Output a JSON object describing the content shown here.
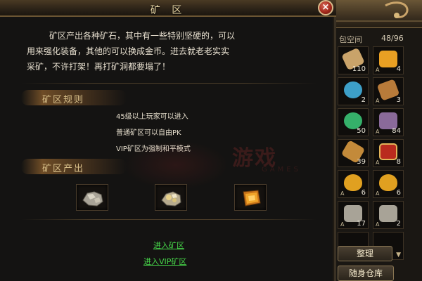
{
  "dialog": {
    "title": "矿 区",
    "close_icon": "×",
    "intro_lines": [
      "矿区产出各种矿石，其中有一些特别坚硬的，可以",
      "用来强化装备，其他的可以换成金币。进去就老老实实",
      "采矿，不许打架！再打矿洞都要塌了！"
    ],
    "rules_title": "矿区规则",
    "rules": [
      "45级以上玩家可以进入",
      "普通矿区可以自由PK",
      "VIP矿区为强制和平模式"
    ],
    "output_title": "矿区产出",
    "output_items": [
      {
        "icon": "silver-ore-icon",
        "color": "#b8b3a4"
      },
      {
        "icon": "mixed-ore-icon",
        "color": "#d0b77a"
      },
      {
        "icon": "gold-ore-icon",
        "color": "#e08a1e"
      }
    ],
    "enter_link": "进入矿区",
    "enter_vip_link": "进入VIP矿区"
  },
  "watermark": {
    "text": "游戏",
    "sub": "GAMES"
  },
  "inventory": {
    "label": "包空间",
    "count": "48/96",
    "slots": [
      {
        "icon": "feather-icon",
        "qty": "110",
        "color": "#c9a36a"
      },
      {
        "icon": "gold-coin-icon",
        "qty": "4",
        "color": "#e9a023"
      },
      {
        "icon": "blue-crystal-icon",
        "qty": "2",
        "color": "#3d9fc8"
      },
      {
        "icon": "scroll-icon",
        "qty": "3",
        "color": "#b87b3a"
      },
      {
        "icon": "green-orb-icon",
        "qty": "50",
        "color": "#35b06a"
      },
      {
        "icon": "gem-icon",
        "qty": "84",
        "color": "#8a6a9a"
      },
      {
        "icon": "scroll-icon",
        "qty": "39",
        "color": "#c38a3a"
      },
      {
        "icon": "red-seal-icon",
        "qty": "8",
        "color": "#b92b1e"
      },
      {
        "icon": "gold-potion-icon",
        "qty": "6",
        "color": "#e0a020"
      },
      {
        "icon": "gold-potion-icon",
        "qty": "6",
        "color": "#e0a020"
      },
      {
        "icon": "ore-icon",
        "qty": "17",
        "color": "#a8a397"
      },
      {
        "icon": "ore-icon",
        "qty": "2",
        "color": "#a8a397"
      },
      {
        "icon": "empty-slot",
        "qty": "",
        "color": "#0f0d0b"
      },
      {
        "icon": "empty-slot",
        "qty": "",
        "color": "#0f0d0b"
      }
    ],
    "sort_button": "整理",
    "storage_button": "随身仓库"
  }
}
